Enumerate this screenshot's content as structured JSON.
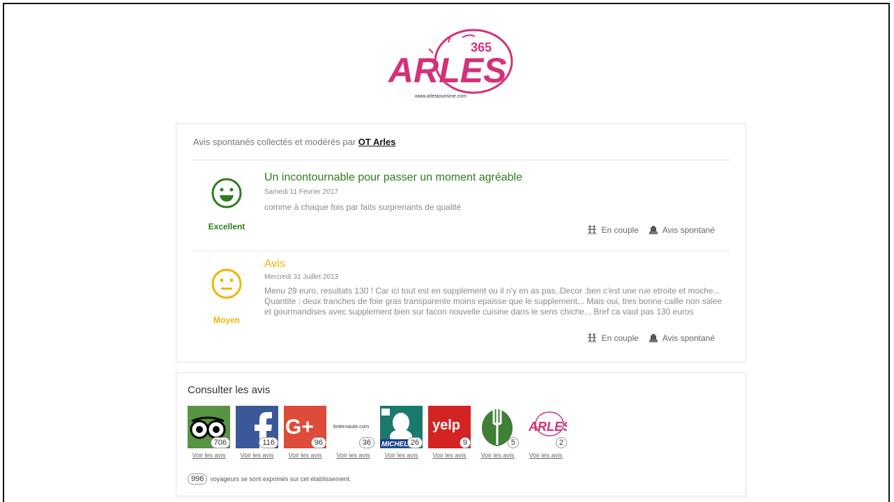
{
  "logo": {
    "text": "ARLES",
    "number": "365",
    "url_text": "www.arlestourisme.com"
  },
  "reviews_header": {
    "prefix": "Avis spontanés collectés et modérés par",
    "org": "OT Arles"
  },
  "reviews": [
    {
      "rating": "Excellent",
      "color": "#2e7d1e",
      "title": "Un incontournable pour passer un moment agréable",
      "date": "Samedi 11 Février 2017",
      "body": "comme à chaque fois par faits surprenants de qualité",
      "tag_companion": "En couple",
      "tag_type": "Avis spontané"
    },
    {
      "rating": "Moyen",
      "color": "#f0b400",
      "title": "Avis",
      "date": "Mercredi 31 Juillet 2013",
      "body": "Menu 29 euro, resultats 130 ! Car ici tout est en supplement ou il n'y en as pas..Decor :ben c'est une rue etroite et moche... Quantite : deux tranches de foie gras transparente moins epaisse que le supplement... Mais oui, tres bonne caille non salee et gourmandises avec supplement bien sur facon nouvelle cuisine dans le sens chiche... Bref ca vaut pas 130 euros",
      "tag_companion": "En couple",
      "tag_type": "Avis spontané"
    }
  ],
  "consult": {
    "title": "Consulter les avis",
    "sources": [
      {
        "name": "TripAdvisor",
        "icon": "tripadvisor-owl-icon",
        "count": "706",
        "link": "Voir les avis",
        "color": "#589442"
      },
      {
        "name": "Facebook",
        "icon": "facebook-icon",
        "count": "116",
        "link": "Voir les avis",
        "color": "#3b5998"
      },
      {
        "name": "Google+",
        "icon": "google-plus-icon",
        "count": "96",
        "link": "Voir les avis",
        "color": "#dd4b39"
      },
      {
        "name": "L'Internaute",
        "icon": "linternaute-icon",
        "count": "36",
        "link": "Voir les avis",
        "color": "#ffffff",
        "logo_text": "linternaute.com"
      },
      {
        "name": "Michelin",
        "icon": "michelin-icon",
        "count": "26",
        "link": "Voir les avis",
        "color": "#1a7a6c",
        "logo_text": "MICHEL"
      },
      {
        "name": "Yelp",
        "icon": "yelp-icon",
        "count": "9",
        "link": "Voir les avis",
        "color": "#d32323",
        "logo_text": "yelp"
      },
      {
        "name": "TheFork",
        "icon": "thefork-icon",
        "count": "5",
        "link": "Voir les avis",
        "color": "#3f7f36"
      },
      {
        "name": "Arles Office",
        "icon": "arles-logo-icon",
        "count": "2",
        "link": "Voir les avis",
        "color": "#ffffff"
      }
    ],
    "total": "996",
    "summary_text": "voyageurs se sont exprimés sur cet établissement."
  }
}
